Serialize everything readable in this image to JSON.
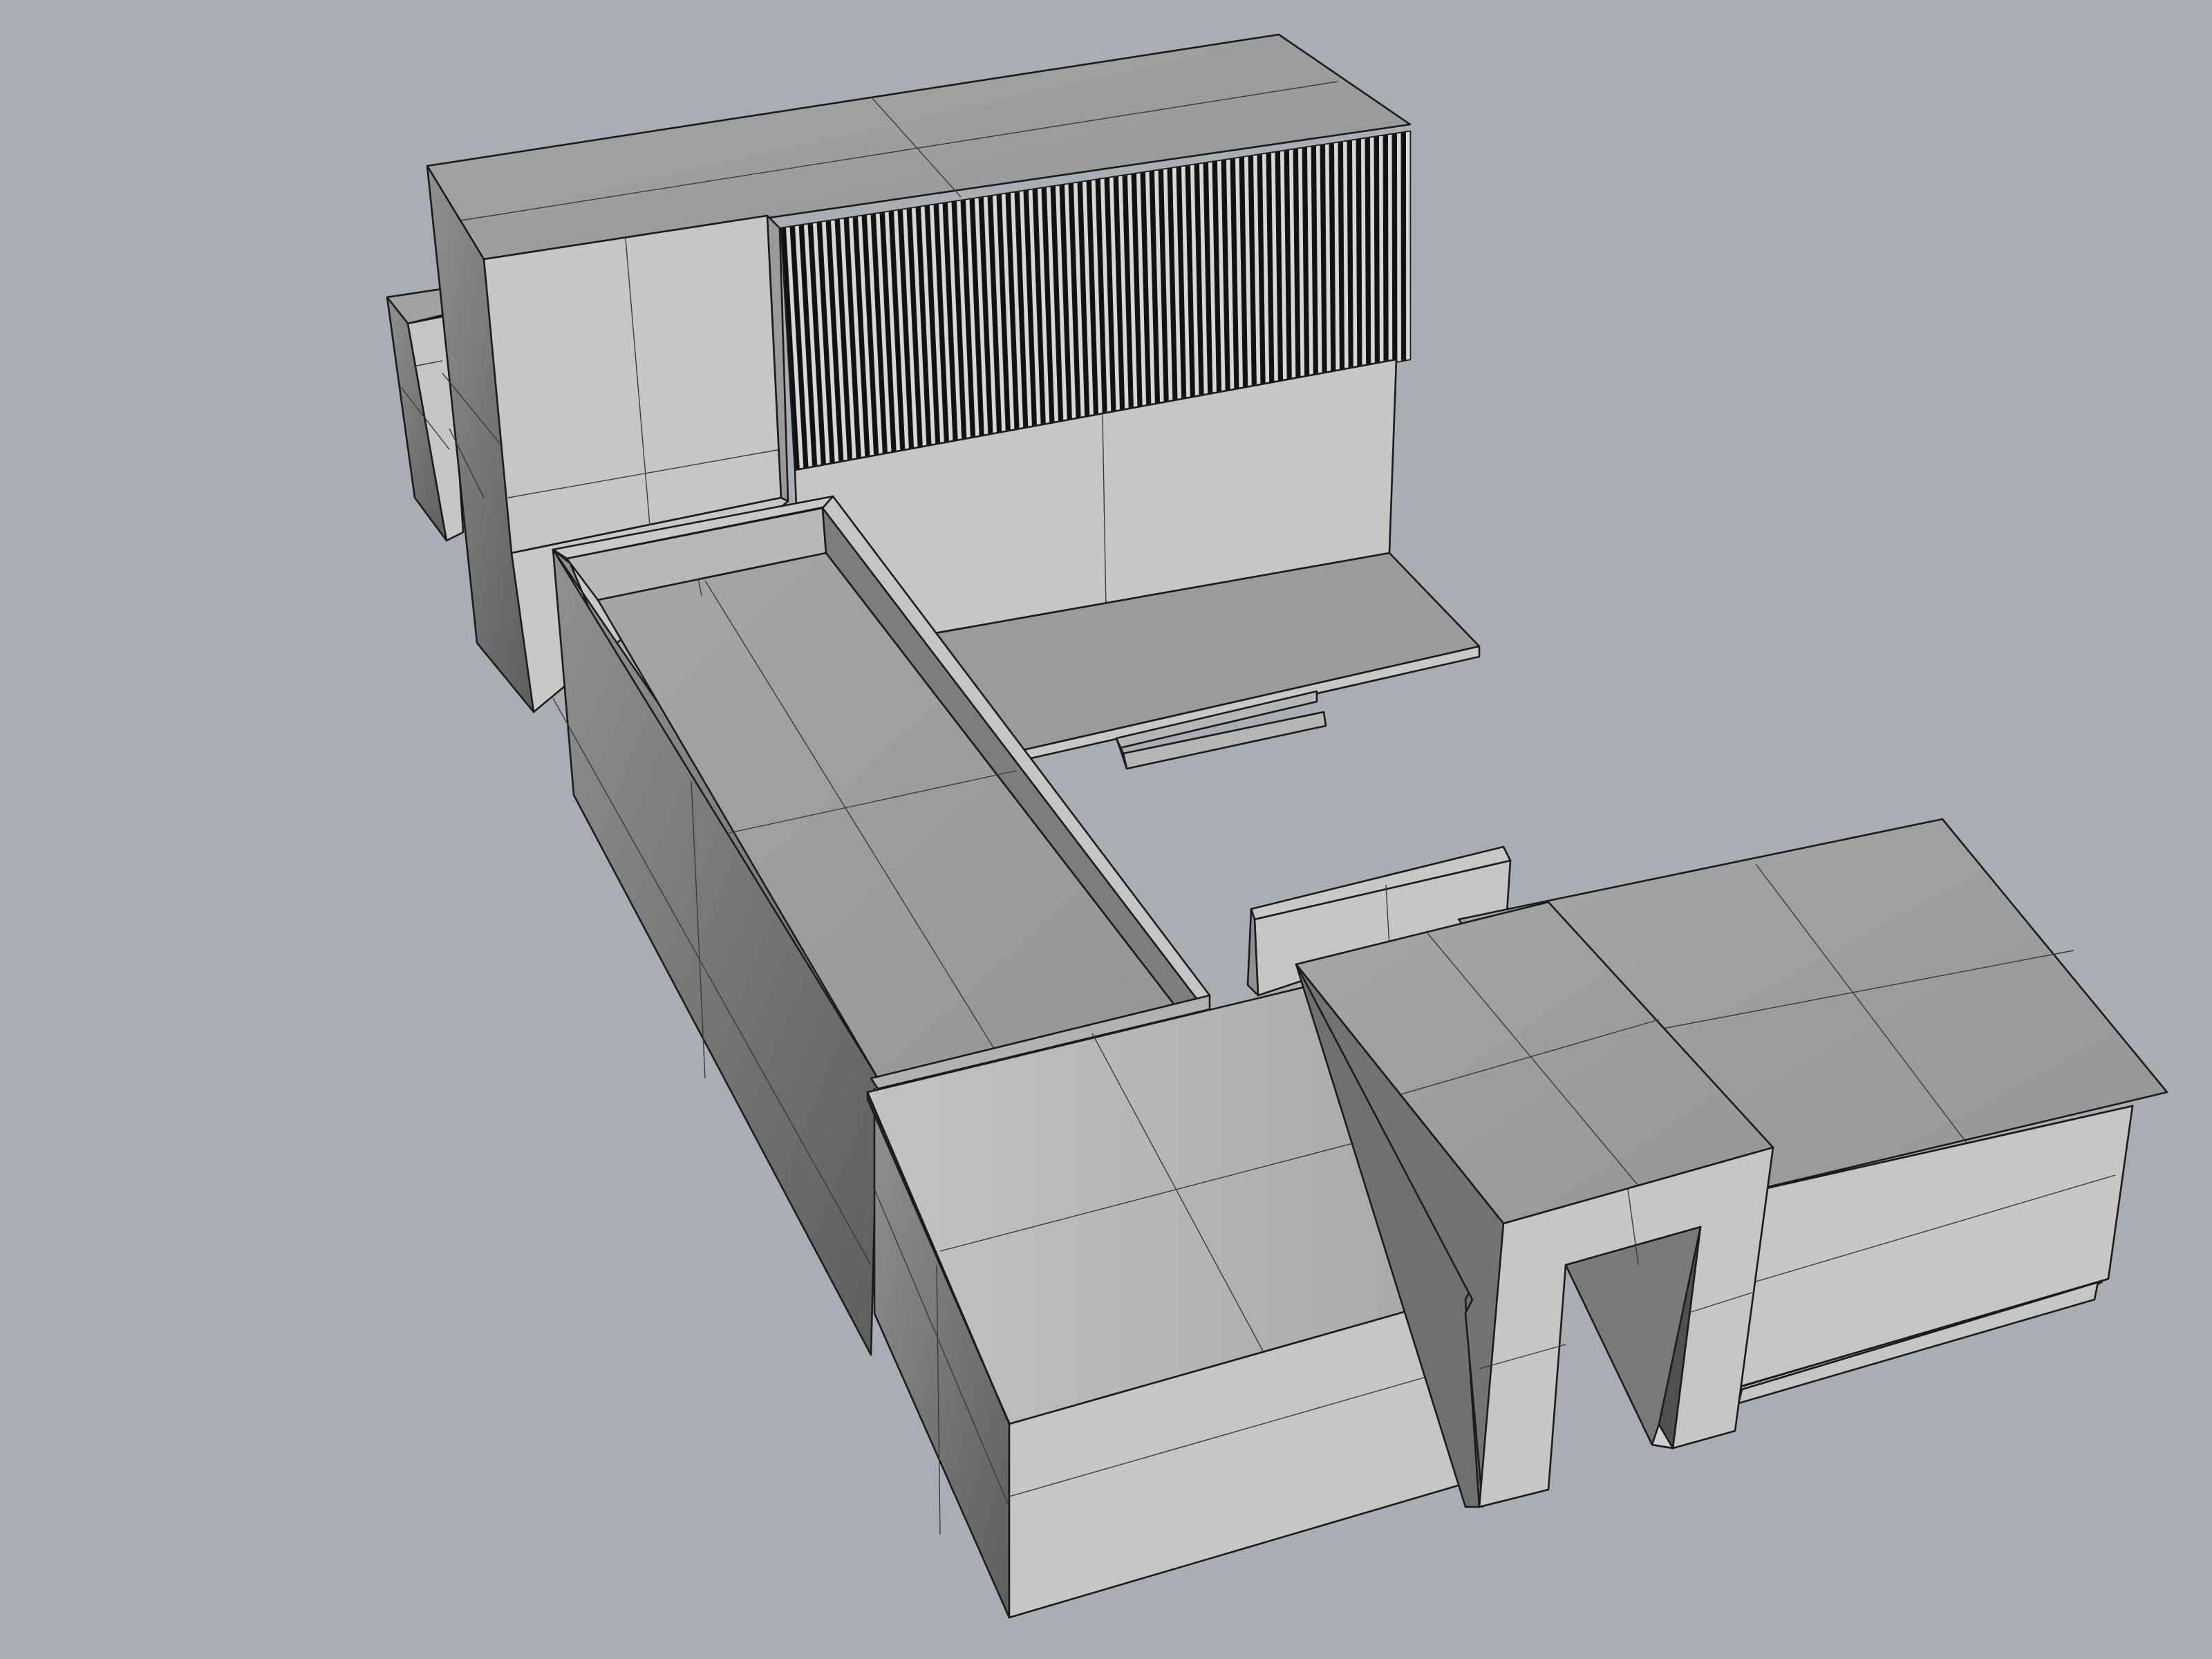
{
  "viewport": {
    "name": "Perspective",
    "background_color": "#a9aeb5",
    "display_mode": "shaded-wireframe"
  },
  "model": {
    "fin_count": 70,
    "colors": {
      "roof": "#9c9d9f",
      "light_face": "#c6c6c4",
      "dark_face": "#6f7070",
      "edge": "#1b1b1b"
    }
  }
}
